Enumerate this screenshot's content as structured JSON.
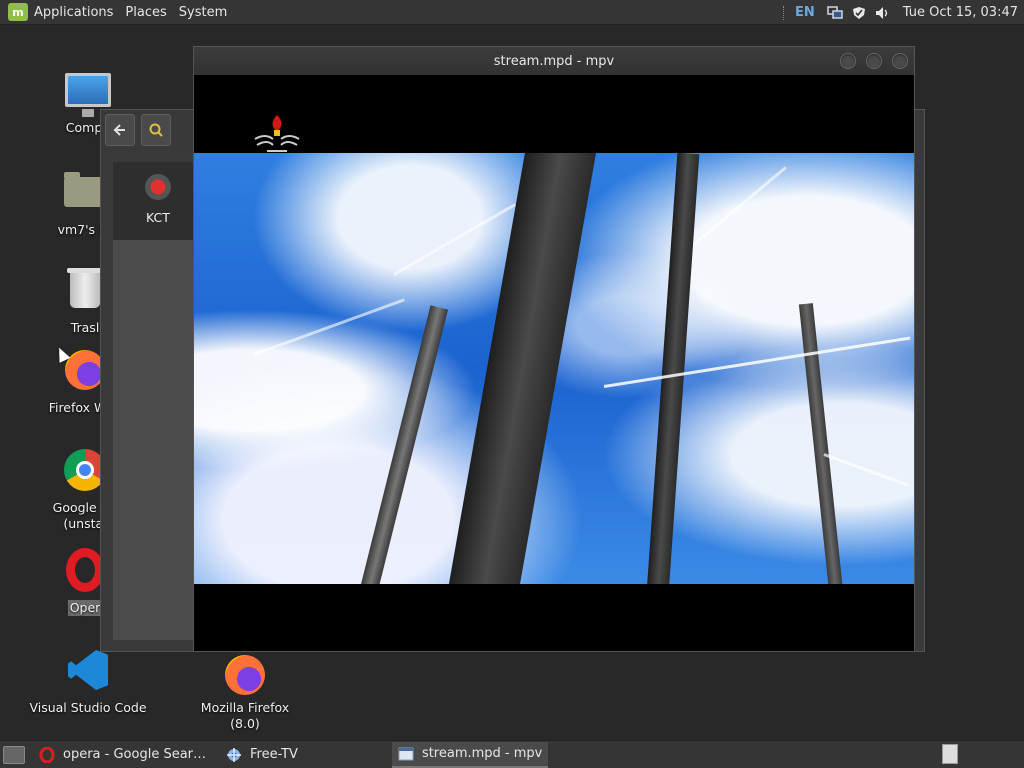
{
  "top_panel": {
    "menus": [
      "Applications",
      "Places",
      "System"
    ],
    "language": "EN",
    "clock": "Tue Oct 15, 03:47",
    "tray_icons": [
      "network-icon",
      "shield-icon",
      "volume-icon"
    ]
  },
  "desktop": {
    "icons": [
      {
        "label": "Compu",
        "icon": "computer-icon"
      },
      {
        "label": "vm7's H",
        "icon": "home-folder-icon"
      },
      {
        "label": "Trasl",
        "icon": "trash-icon"
      },
      {
        "label": "Firefox Web",
        "icon": "firefox-icon"
      },
      {
        "label": "Google Ch\n(unstal",
        "icon": "chrome-dev-icon"
      },
      {
        "label": "Oper",
        "icon": "opera-icon"
      },
      {
        "label": "Visual Studio Code",
        "icon": "vscode-icon"
      },
      {
        "label": "Mozilla Firefox (8.0)",
        "icon": "firefox-icon"
      }
    ]
  },
  "file_manager": {
    "item_label": "KCT"
  },
  "mpv": {
    "title": "stream.mpd - mpv"
  },
  "taskbar": {
    "tasks": [
      {
        "label": "opera - Google Sear…",
        "icon": "opera-icon",
        "active": false
      },
      {
        "label": "Free-TV",
        "icon": "freetv-icon",
        "active": false
      },
      {
        "label": "stream.mpd - mpv",
        "icon": "window-icon",
        "active": true
      }
    ]
  },
  "colors": {
    "panel": "#353535",
    "desktop": "#282828",
    "lang_accent": "#6aa8e0",
    "mint_logo": "#8fbf4a"
  }
}
